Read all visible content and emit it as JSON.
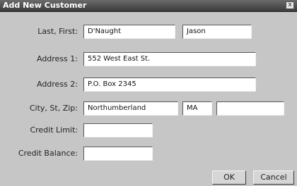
{
  "window": {
    "title": "Add New Customer",
    "close_glyph": "x"
  },
  "fields": {
    "last_first": {
      "label": "Last, First:",
      "last": "D'Naught",
      "first": "Jason"
    },
    "address1": {
      "label": "Address 1:",
      "value": "552 West East St."
    },
    "address2": {
      "label": "Address 2:",
      "value": "P.O. Box 2345"
    },
    "city_st_zip": {
      "label": "City, St, Zip:",
      "city": "Northumberland",
      "state": "MA",
      "zip": ""
    },
    "credit_limit": {
      "label": "Credit Limit:",
      "value": ""
    },
    "credit_balance": {
      "label": "Credit Balance:",
      "value": ""
    }
  },
  "buttons": {
    "ok": "OK",
    "cancel": "Cancel"
  }
}
